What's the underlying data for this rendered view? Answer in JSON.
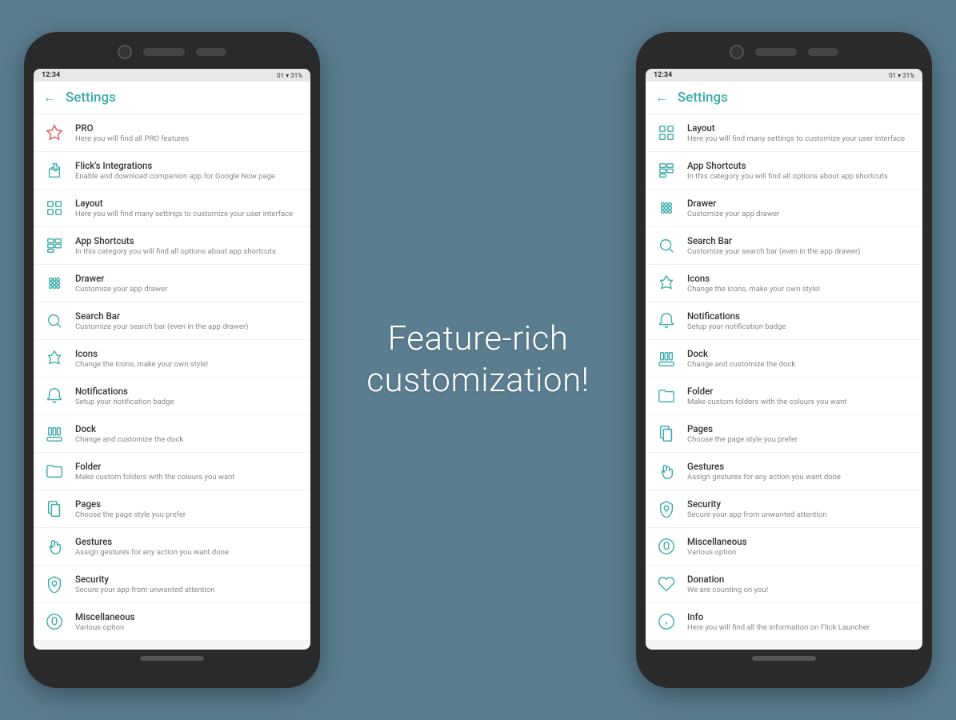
{
  "background_color": "#5a7d8f",
  "center": {
    "line1": "Feature-rich",
    "line2": "customization!"
  },
  "phone_left": {
    "status": {
      "time": "12:34",
      "icons": "01 ▾ 31%"
    },
    "header": {
      "back": "←",
      "title": "Settings"
    },
    "items": [
      {
        "id": "pro",
        "title": "PRO",
        "desc": "Here you will find all PRO features",
        "icon": "star"
      },
      {
        "id": "flicks",
        "title": "Flick's Integrations",
        "desc": "Enable and download companion app for Google Now page",
        "icon": "puzzle"
      },
      {
        "id": "layout",
        "title": "Layout",
        "desc": "Here you will find many settings to customize your user interface",
        "icon": "grid"
      },
      {
        "id": "shortcuts",
        "title": "App Shortcuts",
        "desc": "In this category you will find all options about app shortcuts",
        "icon": "shortcuts"
      },
      {
        "id": "drawer",
        "title": "Drawer",
        "desc": "Customize your app drawer",
        "icon": "drawer"
      },
      {
        "id": "searchbar",
        "title": "Search Bar",
        "desc": "Customize your search bar (even in the app drawer)",
        "icon": "search"
      },
      {
        "id": "icons",
        "title": "Icons",
        "desc": "Change the icons, make your own style!",
        "icon": "icons"
      },
      {
        "id": "notifications",
        "title": "Notifications",
        "desc": "Setup your notification badge",
        "icon": "notifications"
      },
      {
        "id": "dock",
        "title": "Dock",
        "desc": "Change and customize the dock",
        "icon": "dock"
      },
      {
        "id": "folder",
        "title": "Folder",
        "desc": "Make custom folders with the colours you want",
        "icon": "folder"
      },
      {
        "id": "pages",
        "title": "Pages",
        "desc": "Choose the page style you prefer",
        "icon": "pages"
      },
      {
        "id": "gestures",
        "title": "Gestures",
        "desc": "Assign gestures for any action you want done",
        "icon": "gestures"
      },
      {
        "id": "security",
        "title": "Security",
        "desc": "Secure your app from unwanted attention",
        "icon": "security"
      },
      {
        "id": "misc",
        "title": "Miscellaneous",
        "desc": "Various option",
        "icon": "misc"
      }
    ]
  },
  "phone_right": {
    "status": {
      "time": "12:34",
      "icons": "01 ▾ 31%"
    },
    "header": {
      "back": "←",
      "title": "Settings"
    },
    "items": [
      {
        "id": "layout2",
        "title": "Layout",
        "desc": "Here you will find many settings to customize your user interface",
        "icon": "grid"
      },
      {
        "id": "shortcuts2",
        "title": "App Shortcuts",
        "desc": "In this category you will find all options about app shortcuts",
        "icon": "shortcuts"
      },
      {
        "id": "drawer2",
        "title": "Drawer",
        "desc": "Customize your app drawer",
        "icon": "drawer"
      },
      {
        "id": "searchbar2",
        "title": "Search Bar",
        "desc": "Customize your search bar (even in the app drawer)",
        "icon": "search"
      },
      {
        "id": "icons2",
        "title": "Icons",
        "desc": "Change the icons, make your own style!",
        "icon": "icons"
      },
      {
        "id": "notifications2",
        "title": "Notifications",
        "desc": "Setup your notification badge",
        "icon": "notifications"
      },
      {
        "id": "dock2",
        "title": "Dock",
        "desc": "Change and customize the dock",
        "icon": "dock"
      },
      {
        "id": "folder2",
        "title": "Folder",
        "desc": "Make custom folders with the colours you want",
        "icon": "folder"
      },
      {
        "id": "pages2",
        "title": "Pages",
        "desc": "Choose the page style you prefer",
        "icon": "pages"
      },
      {
        "id": "gestures2",
        "title": "Gestures",
        "desc": "Assign gestures for any action you want done",
        "icon": "gestures"
      },
      {
        "id": "security2",
        "title": "Security",
        "desc": "Secure your app from unwanted attention",
        "icon": "security"
      },
      {
        "id": "misc2",
        "title": "Miscellaneous",
        "desc": "Various option",
        "icon": "misc"
      },
      {
        "id": "donation",
        "title": "Donation",
        "desc": "We are counting on you!",
        "icon": "donation"
      },
      {
        "id": "info",
        "title": "Info",
        "desc": "Here you will find all the information on Flick Launcher",
        "icon": "info"
      }
    ]
  }
}
